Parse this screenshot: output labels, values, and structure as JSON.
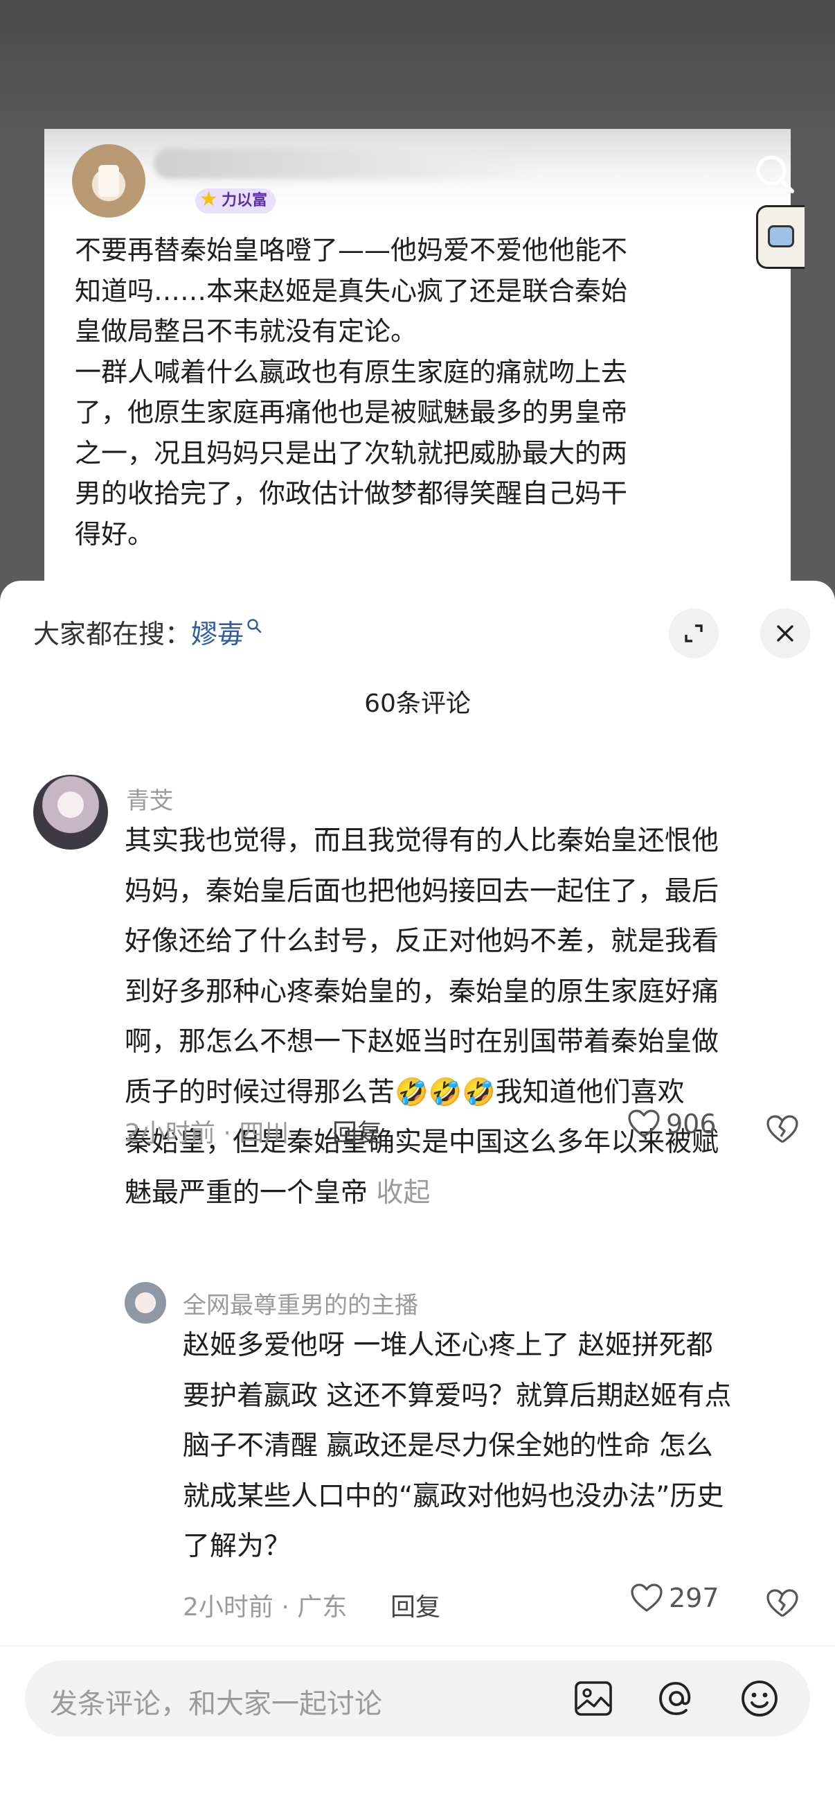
{
  "post": {
    "badge": "力以富",
    "text": "不要再替秦始皇咯噔了——他妈爱不爱他他能不\n知道吗……本来赵姬是真失心疯了还是联合秦始\n皇做局整吕不韦就没有定论。\n一群人喊着什么嬴政也有原生家庭的痛就吻上去\n了，他原生家庭再痛他也是被赋魅最多的男皇帝\n之一，况且妈妈只是出了次轨就把威胁最大的两\n男的收拾完了，你政估计做梦都得笑醒自己妈干\n得好。"
  },
  "sheet": {
    "trend_prefix": "大家都在搜：",
    "trend_keyword": "嫪毐",
    "comment_count": "60条评论"
  },
  "comments": [
    {
      "name": "青芠",
      "text": "其实我也觉得，而且我觉得有的人比秦始皇还恨他\n妈妈，秦始皇后面也把他妈接回去一起住了，最后\n好像还给了什么封号，反正对他妈不差，就是我看\n到好多那种心疼秦始皇的，秦始皇的原生家庭好痛\n啊，那怎么不想一下赵姬当时在别国带着秦始皇做\n质子的时候过得那么苦🤣🤣🤣我知道他们喜欢\n秦始皇，但是秦始皇确实是中国这么多年以来被赋\n魅最严重的一个皇帝",
      "collapse": " 收起",
      "meta": "2小时前 · 四川",
      "reply": "回复",
      "likes": "906"
    },
    {
      "name": "全网最尊重男的的主播",
      "text": "赵姬多爱他呀 一堆人还心疼上了 赵姬拼死都\n要护着嬴政 这还不算爱吗？就算后期赵姬有点\n脑子不清醒 嬴政还是尽力保全她的性命 怎么\n就成某些人口中的“嬴政对他妈也没办法”历史\n了解为？",
      "meta": "2小时前 · 广东",
      "reply": "回复",
      "likes": "297"
    }
  ],
  "input": {
    "placeholder": "发条评论，和大家一起讨论"
  },
  "icons": {
    "search": "search-icon",
    "expand": "expand-icon",
    "close": "close-icon",
    "heart": "heart-icon",
    "dislike": "broken-heart-icon",
    "image": "image-icon",
    "at": "at-icon",
    "emoji": "emoji-icon"
  },
  "colors": {
    "keyword": "#2d5ba6",
    "muted": "#9a9a9a"
  }
}
